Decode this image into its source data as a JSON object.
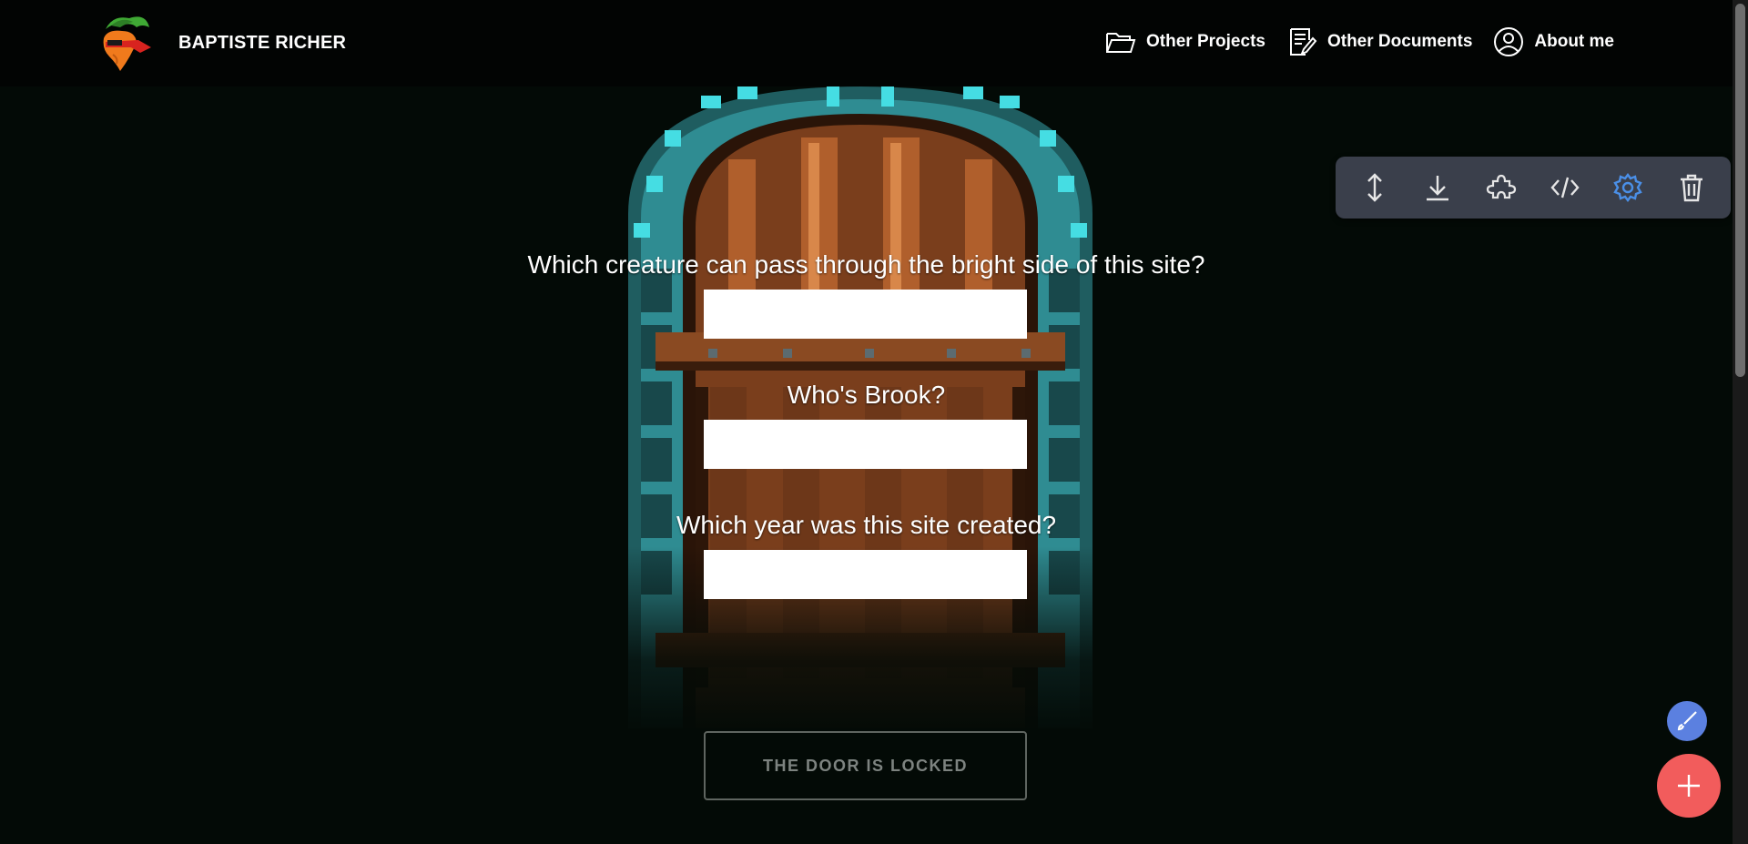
{
  "navbar": {
    "brand_name": "BAPTISTE RICHER",
    "links": [
      {
        "label": "Other Projects",
        "icon": "folder-icon"
      },
      {
        "label": "Other Documents",
        "icon": "document-edit-icon"
      },
      {
        "label": "About me",
        "icon": "user-circle-icon"
      }
    ]
  },
  "form": {
    "questions": [
      {
        "label": "Which creature can pass through the bright side of this site?",
        "value": ""
      },
      {
        "label": "Who's Brook?",
        "value": ""
      },
      {
        "label": "Which year was this site created?",
        "value": ""
      }
    ],
    "submit_label": "THE DOOR IS LOCKED"
  },
  "toolbar": {
    "tools": [
      "resize-vertical-icon",
      "download-icon",
      "puzzle-icon",
      "code-icon",
      "gear-icon",
      "trash-icon"
    ],
    "active_tool": "gear-icon",
    "active_color": "#4a8fe7"
  },
  "colors": {
    "background": "#030a06",
    "fab_edit": "#5b80e0",
    "fab_add": "#f25c5c",
    "door_frame": "#3fd0d6"
  }
}
